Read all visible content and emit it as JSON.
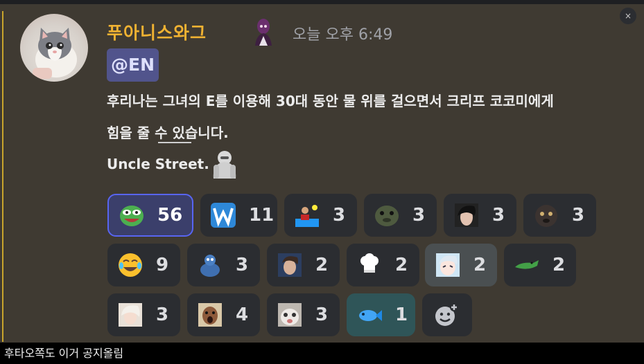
{
  "message": {
    "username": "푸아니스와그",
    "timestamp": "오늘 오후 6:49",
    "mention": "@EN",
    "line1": "후리나는 그녀의 E를 이용해 30대 동안 물 위를 걸으면서 크리프 코코미에게",
    "line2": "힘을 줄 수 있습니다.",
    "line3": "Uncle Street.",
    "accent_color": "#c9a52c",
    "username_color": "#f0b232",
    "role_icon": "purple-character-icon",
    "avatar": "grey-white-cat-avatar"
  },
  "close_label": "×",
  "reactions": [
    {
      "emoji": "pepe-laugh",
      "count": "56",
      "me": true
    },
    {
      "emoji": "blue-w",
      "count": "11"
    },
    {
      "emoji": "water-polo",
      "count": "3"
    },
    {
      "emoji": "seal-face",
      "count": "3"
    },
    {
      "emoji": "dark-haired-face",
      "count": "3"
    },
    {
      "emoji": "dark-animal-face",
      "count": "3"
    },
    {
      "emoji": "joy",
      "count": "9"
    },
    {
      "emoji": "blue-creature",
      "count": "3"
    },
    {
      "emoji": "portrait-man",
      "count": "2"
    },
    {
      "emoji": "chef-hat",
      "count": "2"
    },
    {
      "emoji": "anime-girl",
      "count": "2",
      "light": true
    },
    {
      "emoji": "crocodile",
      "count": "2"
    },
    {
      "emoji": "anime-white-hair",
      "count": "3"
    },
    {
      "emoji": "shocked-man",
      "count": "4"
    },
    {
      "emoji": "cat-face",
      "count": "3"
    },
    {
      "emoji": "fish",
      "count": "1",
      "fish": true
    }
  ],
  "add_reaction_icon": "add-reaction-icon",
  "caption": "후타오쪽도 이거 공지올림"
}
